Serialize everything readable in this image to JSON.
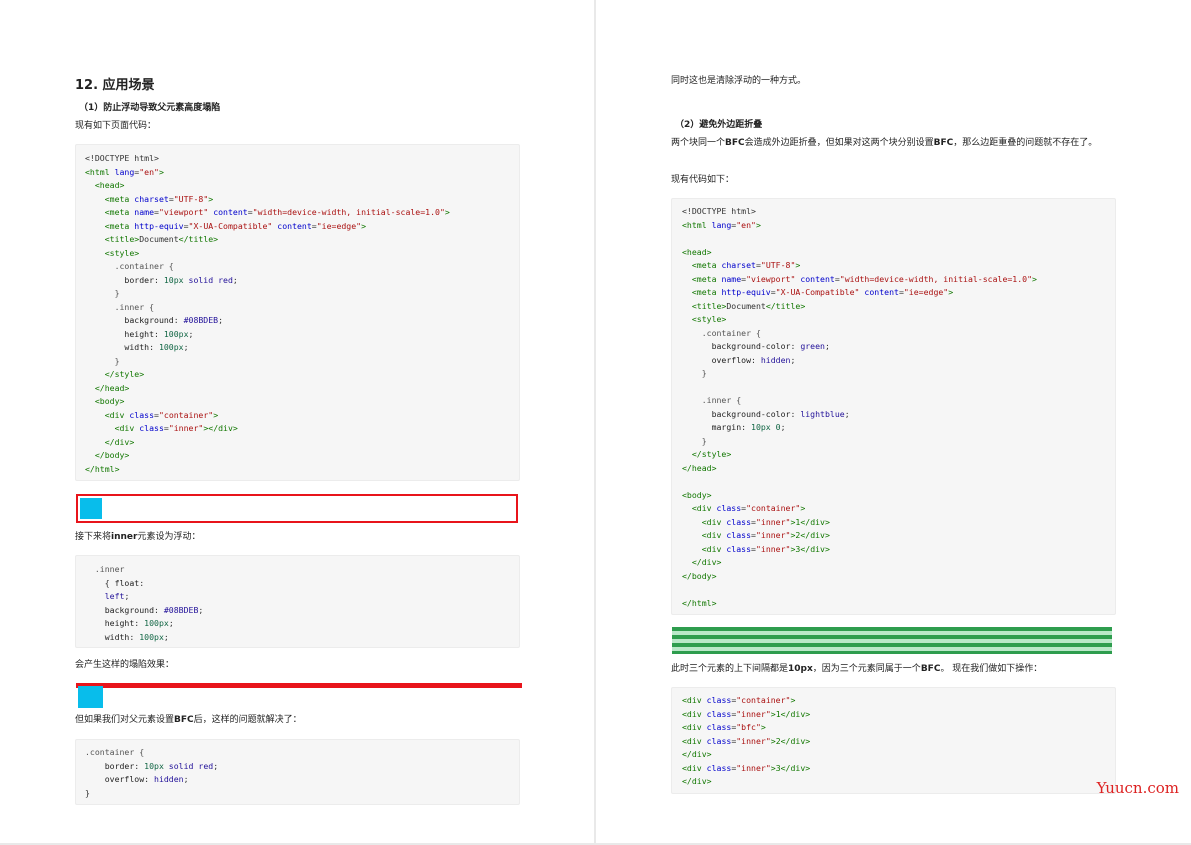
{
  "left": {
    "section_title": "12. 应用场景",
    "sub1": "（1）防止浮动导致父元素高度塌陷",
    "intro1": "现有如下页面代码：",
    "code1": [
      [
        [
          "<!DOCTYPE html>",
          "plain"
        ]
      ],
      [
        [
          "<html ",
          "tag"
        ],
        [
          "lang",
          "attr"
        ],
        [
          "=",
          "plain"
        ],
        [
          "\"en\"",
          "str"
        ],
        [
          ">",
          "tag"
        ]
      ],
      [
        [
          "  <head>",
          "tag"
        ]
      ],
      [
        [
          "    <meta ",
          "tag"
        ],
        [
          "charset",
          "attr"
        ],
        [
          "=",
          "plain"
        ],
        [
          "\"UTF-8\"",
          "str"
        ],
        [
          ">",
          "tag"
        ]
      ],
      [
        [
          "    <meta ",
          "tag"
        ],
        [
          "name",
          "attr"
        ],
        [
          "=",
          "plain"
        ],
        [
          "\"viewport\"",
          "str"
        ],
        [
          " ",
          "plain"
        ],
        [
          "content",
          "attr"
        ],
        [
          "=",
          "plain"
        ],
        [
          "\"width=device-width, initial-scale=1.0\"",
          "str"
        ],
        [
          ">",
          "tag"
        ]
      ],
      [
        [
          "    <meta ",
          "tag"
        ],
        [
          "http-equiv",
          "attr"
        ],
        [
          "=",
          "plain"
        ],
        [
          "\"X-UA-Compatible\"",
          "str"
        ],
        [
          " ",
          "plain"
        ],
        [
          "content",
          "attr"
        ],
        [
          "=",
          "plain"
        ],
        [
          "\"ie=edge\"",
          "str"
        ],
        [
          ">",
          "tag"
        ]
      ],
      [
        [
          "    <title>",
          "tag"
        ],
        [
          "Document",
          "plain"
        ],
        [
          "</title>",
          "tag"
        ]
      ],
      [
        [
          "    <style>",
          "tag"
        ]
      ],
      [
        [
          "      .container {",
          "sel"
        ]
      ],
      [
        [
          "        border",
          "prop"
        ],
        [
          ": ",
          "plain"
        ],
        [
          "10px",
          "num"
        ],
        [
          " solid ",
          "val"
        ],
        [
          "red",
          "val"
        ],
        [
          ";",
          "plain"
        ]
      ],
      [
        [
          "      }",
          "sel"
        ]
      ],
      [
        [
          "      .inner {",
          "sel"
        ]
      ],
      [
        [
          "        background",
          "prop"
        ],
        [
          ": ",
          "plain"
        ],
        [
          "#08BDEB",
          "val"
        ],
        [
          ";",
          "plain"
        ]
      ],
      [
        [
          "        height",
          "prop"
        ],
        [
          ": ",
          "plain"
        ],
        [
          "100px",
          "num"
        ],
        [
          ";",
          "plain"
        ]
      ],
      [
        [
          "        width",
          "prop"
        ],
        [
          ": ",
          "plain"
        ],
        [
          "100px",
          "num"
        ],
        [
          ";",
          "plain"
        ]
      ],
      [
        [
          "      }",
          "sel"
        ]
      ],
      [
        [
          "    </style>",
          "tag"
        ]
      ],
      [
        [
          "  </head>",
          "tag"
        ]
      ],
      [
        [
          "  <body>",
          "tag"
        ]
      ],
      [
        [
          "    <div ",
          "tag"
        ],
        [
          "class",
          "attr"
        ],
        [
          "=",
          "plain"
        ],
        [
          "\"container\"",
          "str"
        ],
        [
          ">",
          "tag"
        ]
      ],
      [
        [
          "      <div ",
          "tag"
        ],
        [
          "class",
          "attr"
        ],
        [
          "=",
          "plain"
        ],
        [
          "\"inner\"",
          "str"
        ],
        [
          "></div>",
          "tag"
        ]
      ],
      [
        [
          "    </div>",
          "tag"
        ]
      ],
      [
        [
          "  </body>",
          "tag"
        ]
      ],
      [
        [
          "</html>",
          "tag"
        ]
      ]
    ],
    "intro2_pre": "接下来将",
    "intro2_bold": "inner",
    "intro2_post": "元素设为浮动：",
    "code2": [
      [
        [
          "  .inner",
          "sel"
        ]
      ],
      [
        [
          "    { ",
          "plain"
        ],
        [
          "float",
          "prop"
        ],
        [
          ":",
          "plain"
        ]
      ],
      [
        [
          "    left",
          "val"
        ],
        [
          ";",
          "plain"
        ]
      ],
      [
        [
          "    background",
          "prop"
        ],
        [
          ": ",
          "plain"
        ],
        [
          "#08BDEB",
          "val"
        ],
        [
          ";",
          "plain"
        ]
      ],
      [
        [
          "    height",
          "prop"
        ],
        [
          ": ",
          "plain"
        ],
        [
          "100px",
          "num"
        ],
        [
          ";",
          "plain"
        ]
      ],
      [
        [
          "    width",
          "prop"
        ],
        [
          ": ",
          "plain"
        ],
        [
          "100px",
          "num"
        ],
        [
          ";",
          "plain"
        ]
      ],
      [
        [
          "  }",
          "plain"
        ]
      ]
    ],
    "intro3": "会产生这样的塌陷效果：",
    "intro4_pre": "但如果我们对父元素设置",
    "intro4_bold": "BFC",
    "intro4_post": "后，这样的问题就解决了：",
    "code3": [
      [
        [
          ".container {",
          "sel"
        ]
      ],
      [
        [
          "    border",
          "prop"
        ],
        [
          ": ",
          "plain"
        ],
        [
          "10px",
          "num"
        ],
        [
          " solid ",
          "val"
        ],
        [
          "red",
          "val"
        ],
        [
          ";",
          "plain"
        ]
      ],
      [
        [
          "    overflow",
          "prop"
        ],
        [
          ": ",
          "plain"
        ],
        [
          "hidden",
          "val"
        ],
        [
          ";",
          "plain"
        ]
      ],
      [
        [
          "}",
          "plain"
        ]
      ]
    ]
  },
  "right": {
    "cont": "同时这也是清除浮动的一种方式。",
    "sub2": "（2）避免外边距折叠",
    "p1_a": "两个块同一个",
    "p1_b": "BFC",
    "p1_c": "会造成外边距折叠，但如果对这两个块分别设置",
    "p1_d": "BFC",
    "p1_e": "，那么边距重叠的问题就不存在了。",
    "intro5": "现有代码如下：",
    "code4": [
      [
        [
          "<!DOCTYPE html>",
          "plain"
        ]
      ],
      [
        [
          "<html ",
          "tag"
        ],
        [
          "lang",
          "attr"
        ],
        [
          "=",
          "plain"
        ],
        [
          "\"en\"",
          "str"
        ],
        [
          ">",
          "tag"
        ]
      ],
      [
        [
          "",
          "plain"
        ]
      ],
      [
        [
          "<head>",
          "tag"
        ]
      ],
      [
        [
          "  <meta ",
          "tag"
        ],
        [
          "charset",
          "attr"
        ],
        [
          "=",
          "plain"
        ],
        [
          "\"UTF-8\"",
          "str"
        ],
        [
          ">",
          "tag"
        ]
      ],
      [
        [
          "  <meta ",
          "tag"
        ],
        [
          "name",
          "attr"
        ],
        [
          "=",
          "plain"
        ],
        [
          "\"viewport\"",
          "str"
        ],
        [
          " ",
          "plain"
        ],
        [
          "content",
          "attr"
        ],
        [
          "=",
          "plain"
        ],
        [
          "\"width=device-width, initial-scale=1.0\"",
          "str"
        ],
        [
          ">",
          "tag"
        ]
      ],
      [
        [
          "  <meta ",
          "tag"
        ],
        [
          "http-equiv",
          "attr"
        ],
        [
          "=",
          "plain"
        ],
        [
          "\"X-UA-Compatible\"",
          "str"
        ],
        [
          " ",
          "plain"
        ],
        [
          "content",
          "attr"
        ],
        [
          "=",
          "plain"
        ],
        [
          "\"ie=edge\"",
          "str"
        ],
        [
          ">",
          "tag"
        ]
      ],
      [
        [
          "  <title>",
          "tag"
        ],
        [
          "Document",
          "plain"
        ],
        [
          "</title>",
          "tag"
        ]
      ],
      [
        [
          "  <style>",
          "tag"
        ]
      ],
      [
        [
          "    .container {",
          "sel"
        ]
      ],
      [
        [
          "      background-color",
          "prop"
        ],
        [
          ": ",
          "plain"
        ],
        [
          "green",
          "val"
        ],
        [
          ";",
          "plain"
        ]
      ],
      [
        [
          "      overflow",
          "prop"
        ],
        [
          ": ",
          "plain"
        ],
        [
          "hidden",
          "val"
        ],
        [
          ";",
          "plain"
        ]
      ],
      [
        [
          "    }",
          "sel"
        ]
      ],
      [
        [
          "",
          "plain"
        ]
      ],
      [
        [
          "    .inner {",
          "sel"
        ]
      ],
      [
        [
          "      background-color",
          "prop"
        ],
        [
          ": ",
          "plain"
        ],
        [
          "lightblue",
          "val"
        ],
        [
          ";",
          "plain"
        ]
      ],
      [
        [
          "      margin",
          "prop"
        ],
        [
          ": ",
          "plain"
        ],
        [
          "10px 0",
          "num"
        ],
        [
          ";",
          "plain"
        ]
      ],
      [
        [
          "    }",
          "sel"
        ]
      ],
      [
        [
          "  </style>",
          "tag"
        ]
      ],
      [
        [
          "</head>",
          "tag"
        ]
      ],
      [
        [
          "",
          "plain"
        ]
      ],
      [
        [
          "<body>",
          "tag"
        ]
      ],
      [
        [
          "  <div ",
          "tag"
        ],
        [
          "class",
          "attr"
        ],
        [
          "=",
          "plain"
        ],
        [
          "\"container\"",
          "str"
        ],
        [
          ">",
          "tag"
        ]
      ],
      [
        [
          "    <div ",
          "tag"
        ],
        [
          "class",
          "attr"
        ],
        [
          "=",
          "plain"
        ],
        [
          "\"inner\"",
          "str"
        ],
        [
          ">1</div>",
          "tag"
        ]
      ],
      [
        [
          "    <div ",
          "tag"
        ],
        [
          "class",
          "attr"
        ],
        [
          "=",
          "plain"
        ],
        [
          "\"inner\"",
          "str"
        ],
        [
          ">2</div>",
          "tag"
        ]
      ],
      [
        [
          "    <div ",
          "tag"
        ],
        [
          "class",
          "attr"
        ],
        [
          "=",
          "plain"
        ],
        [
          "\"inner\"",
          "str"
        ],
        [
          ">3</div>",
          "tag"
        ]
      ],
      [
        [
          "  </div>",
          "tag"
        ]
      ],
      [
        [
          "</body>",
          "tag"
        ]
      ],
      [
        [
          "",
          "plain"
        ]
      ],
      [
        [
          "</html>",
          "tag"
        ]
      ]
    ],
    "p2_a": "此时三个元素的上下间隔都是",
    "p2_b": "10px",
    "p2_c": "，因为三个元素同属于一个",
    "p2_d": "BFC",
    "p2_e": "。 现在我们做如下操作：",
    "code5": [
      [
        [
          "<div ",
          "tag"
        ],
        [
          "class",
          "attr"
        ],
        [
          "=",
          "plain"
        ],
        [
          "\"container\"",
          "str"
        ],
        [
          ">",
          "tag"
        ]
      ],
      [
        [
          "<div ",
          "tag"
        ],
        [
          "class",
          "attr"
        ],
        [
          "=",
          "plain"
        ],
        [
          "\"inner\"",
          "str"
        ],
        [
          ">1</div>",
          "tag"
        ]
      ],
      [
        [
          "<div ",
          "tag"
        ],
        [
          "class",
          "attr"
        ],
        [
          "=",
          "plain"
        ],
        [
          "\"bfc\"",
          "str"
        ],
        [
          ">",
          "tag"
        ]
      ],
      [
        [
          "<div ",
          "tag"
        ],
        [
          "class",
          "attr"
        ],
        [
          "=",
          "plain"
        ],
        [
          "\"inner\"",
          "str"
        ],
        [
          ">2</div>",
          "tag"
        ]
      ],
      [
        [
          "</div>",
          "tag"
        ]
      ],
      [
        [
          "<div ",
          "tag"
        ],
        [
          "class",
          "attr"
        ],
        [
          "=",
          "plain"
        ],
        [
          "\"inner\"",
          "str"
        ],
        [
          ">3</div>",
          "tag"
        ]
      ],
      [
        [
          "</div>",
          "tag"
        ]
      ]
    ]
  },
  "watermark": "Yuucn.com",
  "colors": {
    "red_border": "#e8141b",
    "inner_blue": "#08BDEB",
    "green": "#2e9d4e",
    "lightblue": "#b9e8c8"
  }
}
